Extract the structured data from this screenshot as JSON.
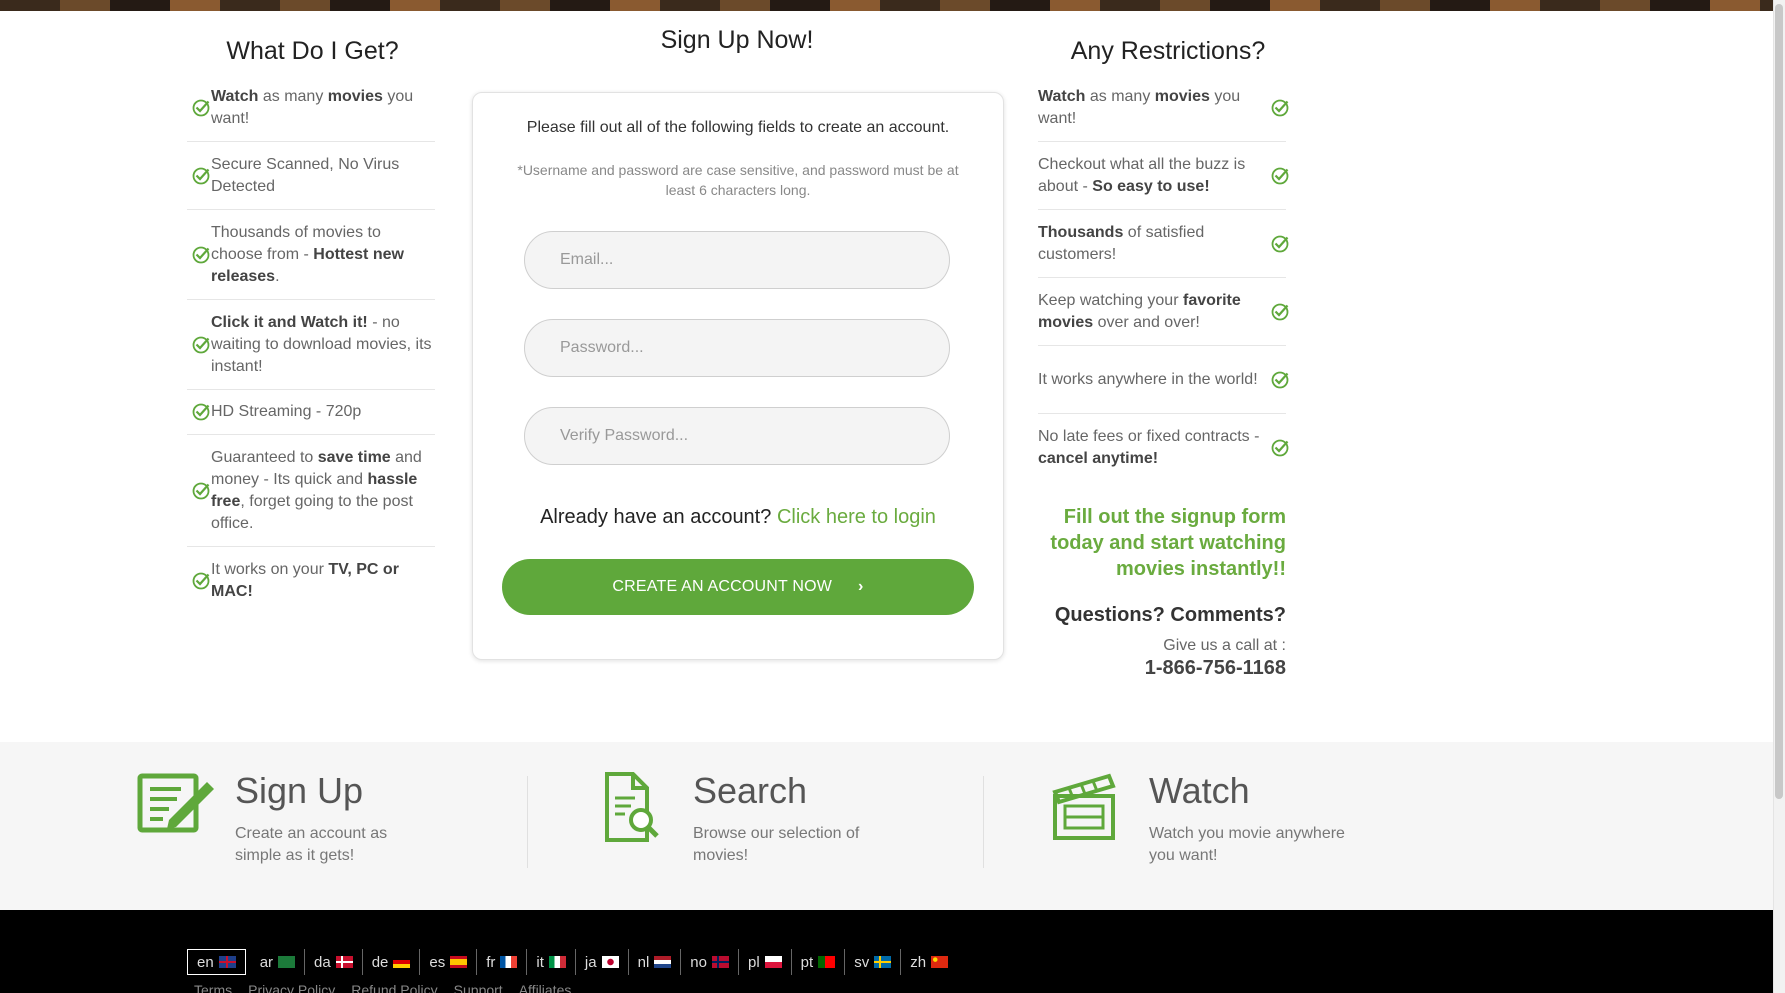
{
  "left_column": {
    "title": "What Do I Get?",
    "items": [
      {
        "segments": [
          [
            "Watch",
            true
          ],
          [
            " as many ",
            false
          ],
          [
            "movies",
            true
          ],
          [
            " you want!",
            false
          ]
        ]
      },
      {
        "segments": [
          [
            "Secure Scanned, No Virus Detected",
            false
          ]
        ]
      },
      {
        "segments": [
          [
            "Thousands of movies to choose from - ",
            false
          ],
          [
            "Hottest new releases",
            true
          ],
          [
            ".",
            false
          ]
        ]
      },
      {
        "segments": [
          [
            "Click it and Watch it!",
            true
          ],
          [
            " - no waiting to download movies, its instant!",
            false
          ]
        ]
      },
      {
        "segments": [
          [
            "HD Streaming - 720p",
            false
          ]
        ]
      },
      {
        "segments": [
          [
            "Guaranteed to ",
            false
          ],
          [
            "save time",
            true
          ],
          [
            " and money - Its quick and ",
            false
          ],
          [
            "hassle free",
            true
          ],
          [
            ", forget going to the post office.",
            false
          ]
        ]
      },
      {
        "segments": [
          [
            "It works on your ",
            false
          ],
          [
            "TV, PC or MAC!",
            true
          ]
        ]
      }
    ]
  },
  "form": {
    "title": "Sign Up Now!",
    "intro": "Please fill out all of the following fields to create an account.",
    "note": "*Username and password are case sensitive, and password must be at least 6 characters long.",
    "email_placeholder": "Email...",
    "password_placeholder": "Password...",
    "verify_placeholder": "Verify Password...",
    "login_prompt": "Already have an account?",
    "login_link": "Click here to login",
    "submit_label": "CREATE AN ACCOUNT NOW",
    "submit_chevron": "›"
  },
  "right_column": {
    "title": "Any Restrictions?",
    "items": [
      {
        "segments": [
          [
            "Watch",
            true
          ],
          [
            " as many ",
            false
          ],
          [
            "movies",
            true
          ],
          [
            " you want!",
            false
          ]
        ]
      },
      {
        "segments": [
          [
            "Checkout what all the buzz is about - ",
            false
          ],
          [
            "So easy to use!",
            true
          ]
        ]
      },
      {
        "segments": [
          [
            "Thousands",
            true
          ],
          [
            " of satisfied customers!",
            false
          ]
        ]
      },
      {
        "segments": [
          [
            "Keep watching your ",
            false
          ],
          [
            "favorite movies",
            true
          ],
          [
            " over and over!",
            false
          ]
        ]
      },
      {
        "segments": [
          [
            "It works anywhere in the world!",
            false
          ]
        ]
      },
      {
        "segments": [
          [
            "No late fees or fixed contracts - ",
            false
          ],
          [
            "cancel anytime!",
            true
          ]
        ]
      }
    ],
    "promo": "Fill out the signup form today and start watching movies instantly!!",
    "questions_title": "Questions? Comments?",
    "call_label": "Give us a call at :",
    "phone": "1-866-756-1168"
  },
  "steps": [
    {
      "title": "Sign Up",
      "desc": "Create an account as simple as it gets!",
      "icon": "signup-form-icon"
    },
    {
      "title": "Search",
      "desc": "Browse our selection of movies!",
      "icon": "search-document-icon"
    },
    {
      "title": "Watch",
      "desc": "Watch you movie anywhere you want!",
      "icon": "clapperboard-icon"
    }
  ],
  "languages": [
    {
      "code": "en",
      "flag": "uk-flag",
      "active": true
    },
    {
      "code": "ar",
      "flag": "saudi-flag"
    },
    {
      "code": "da",
      "flag": "denmark-flag"
    },
    {
      "code": "de",
      "flag": "germany-flag"
    },
    {
      "code": "es",
      "flag": "spain-flag"
    },
    {
      "code": "fr",
      "flag": "france-flag"
    },
    {
      "code": "it",
      "flag": "italy-flag"
    },
    {
      "code": "ja",
      "flag": "japan-flag"
    },
    {
      "code": "nl",
      "flag": "netherlands-flag"
    },
    {
      "code": "no",
      "flag": "norway-flag"
    },
    {
      "code": "pl",
      "flag": "poland-flag"
    },
    {
      "code": "pt",
      "flag": "portugal-flag"
    },
    {
      "code": "sv",
      "flag": "sweden-flag"
    },
    {
      "code": "zh",
      "flag": "china-flag"
    }
  ],
  "footer_links": [
    "Terms",
    "Privacy Policy",
    "Refund Policy",
    "Support",
    "Affiliates"
  ],
  "colors": {
    "accent": "#5fa83b",
    "link": "#6aab3f",
    "footer_bg": "#000000",
    "band_bg": "#f6f6f6"
  }
}
